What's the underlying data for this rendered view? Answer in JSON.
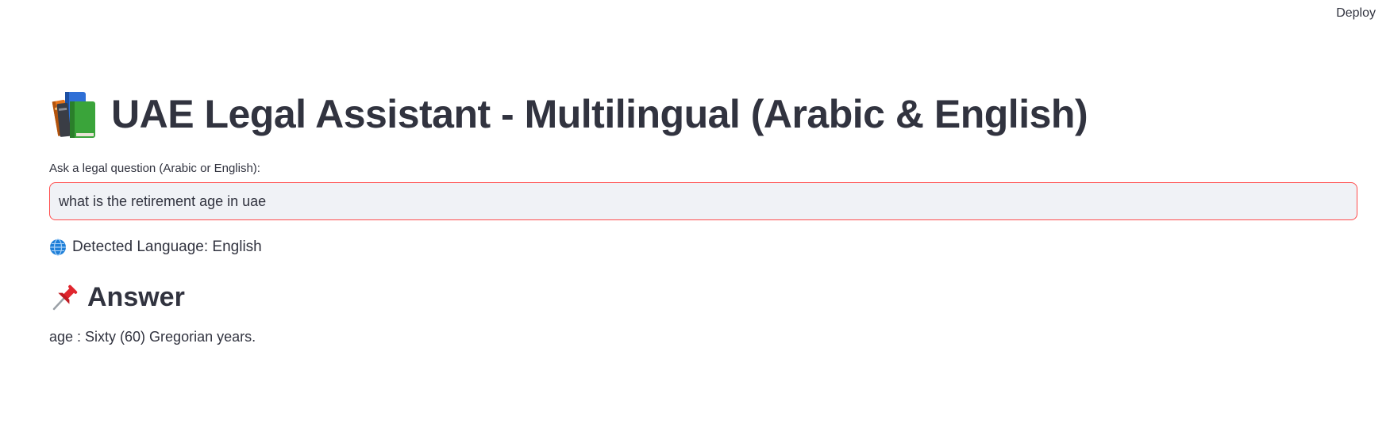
{
  "header": {
    "deploy_label": "Deploy"
  },
  "main": {
    "title_icon": "books-icon",
    "title": "UAE Legal Assistant - Multilingual (Arabic & English)",
    "question_label": "Ask a legal question (Arabic or English):",
    "question_value": "what is the retirement age in uae",
    "detected_icon": "globe-icon",
    "detected_language": "Detected Language: English",
    "answer_icon": "pushpin-icon",
    "answer_heading": "Answer",
    "answer_text": "age : Sixty (60) Gregorian years."
  },
  "colors": {
    "text": "#31333f",
    "input_border": "#ff4b4b",
    "input_bg": "#f0f2f6"
  }
}
